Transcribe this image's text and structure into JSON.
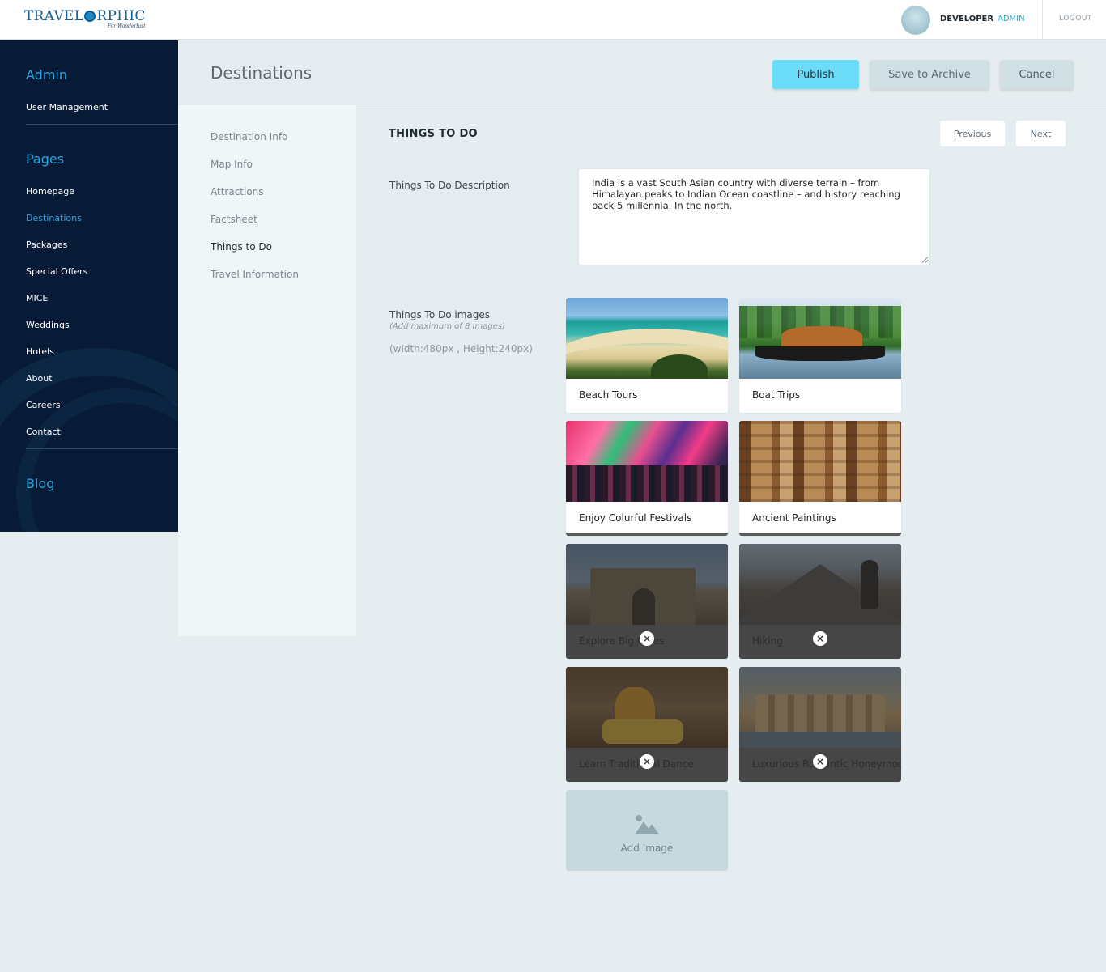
{
  "brand": {
    "logo_text_left": "TRAVEL",
    "logo_text_right": "RPHIC",
    "tagline": "For Wanderlust"
  },
  "user": {
    "name": "DEVELOPER",
    "role": "ADMIN",
    "logout": "LOGOUT"
  },
  "sidebar": {
    "admin_heading": "Admin",
    "admin_items": [
      {
        "label": "User Management"
      }
    ],
    "pages_heading": "Pages",
    "pages_items": [
      {
        "label": "Homepage"
      },
      {
        "label": "Destinations",
        "active": true
      },
      {
        "label": "Packages"
      },
      {
        "label": "Special Offers"
      },
      {
        "label": "MICE"
      },
      {
        "label": "Weddings"
      },
      {
        "label": "Hotels"
      },
      {
        "label": "About"
      },
      {
        "label": "Careers"
      },
      {
        "label": "Contact"
      }
    ],
    "blog_heading": "Blog"
  },
  "header": {
    "title": "Destinations",
    "publish": "Publish",
    "archive": "Save to Archive",
    "cancel": "Cancel"
  },
  "subnav": {
    "items": [
      {
        "label": "Destination Info"
      },
      {
        "label": "Map Info"
      },
      {
        "label": "Attractions"
      },
      {
        "label": "Factsheet"
      },
      {
        "label": "Things to Do",
        "active": true
      },
      {
        "label": "Travel Information"
      }
    ]
  },
  "section": {
    "title": "THINGS TO DO",
    "previous": "Previous",
    "next": "Next",
    "description_label": "Things To Do Description",
    "description_value": "India is a vast South Asian country with diverse terrain – from Himalayan peaks to Indian Ocean coastline – and history reaching back 5 millennia. In the north.",
    "images_label": "Things To Do images",
    "images_hint": "(Add maximum of 8 Images)",
    "images_dimensions": "(width:480px , Height:240px)",
    "add_image": "Add Image"
  },
  "cards": [
    {
      "caption": "Beach Tours",
      "image": "beach"
    },
    {
      "caption": "Boat Trips",
      "image": "boat"
    },
    {
      "caption": "Enjoy Colurful Festivals",
      "image": "holi"
    },
    {
      "caption": "Ancient Paintings",
      "image": "paintings"
    },
    {
      "caption": "Explore Big Cities",
      "image": "gateway"
    },
    {
      "caption": "Hiking",
      "image": "hiking"
    },
    {
      "caption": "Learn Traditional Dance",
      "image": "dance"
    },
    {
      "caption": "Luxurious Romantic Honeymoon",
      "image": "palace"
    }
  ],
  "colors": {
    "accent": "#2aa6e0",
    "sidebar_bg": "#071b36",
    "publish_bg": "#6bdcf8"
  }
}
